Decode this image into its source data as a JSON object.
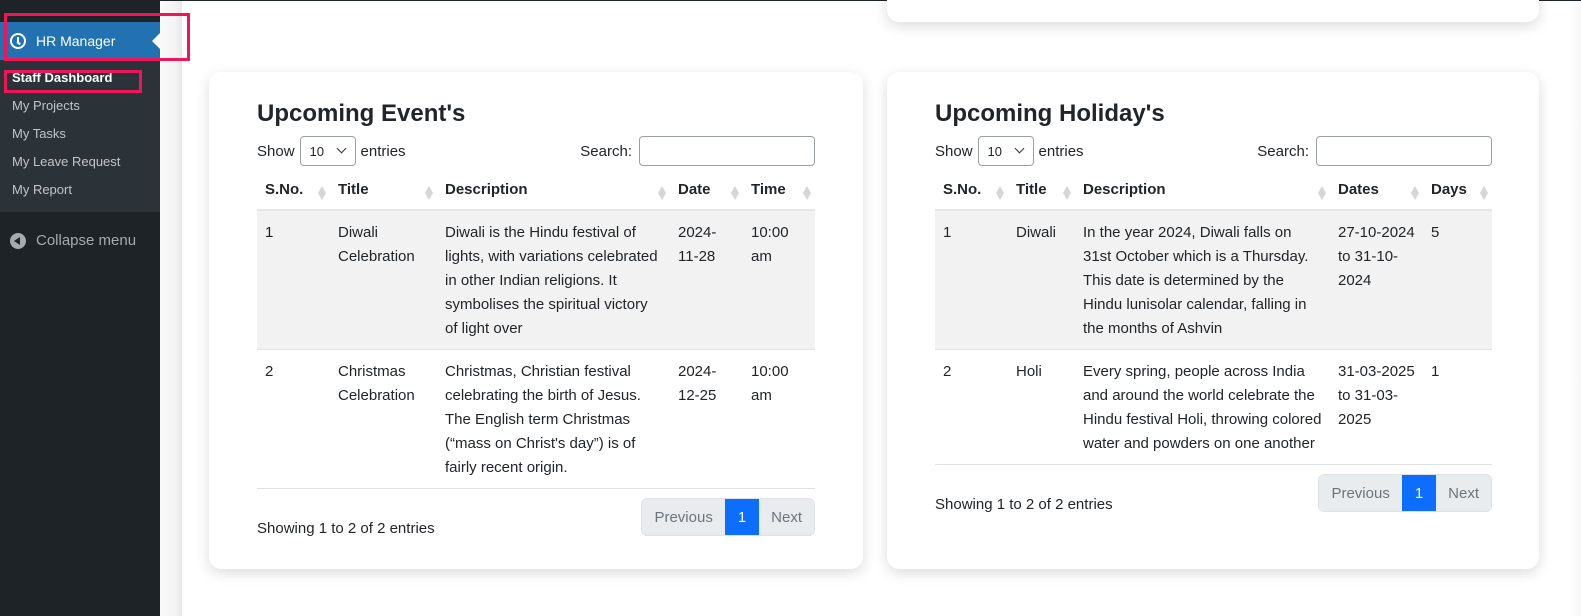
{
  "sidebar": {
    "menu_title": "HR Manager",
    "items": [
      {
        "label": "Staff Dashboard",
        "current": true
      },
      {
        "label": "My Projects"
      },
      {
        "label": "My Tasks"
      },
      {
        "label": "My Leave Request"
      },
      {
        "label": "My Report"
      }
    ],
    "collapse_label": "Collapse menu"
  },
  "colors": {
    "sidebar_bg": "#1d2327",
    "menu_active": "#2271b1",
    "highlight": "#f0145a",
    "page_active": "#0d6efd"
  },
  "events": {
    "title": "Upcoming Event's",
    "show_label": "Show",
    "entries_value": "10",
    "entries_label": "entries",
    "search_label": "Search:",
    "search_value": "",
    "columns": [
      "S.No.",
      "Title",
      "Description",
      "Date",
      "Time"
    ],
    "rows": [
      [
        "1",
        "Diwali Celebration",
        "Diwali is the Hindu festival of lights, with variations celebrated in other Indian religions. It symbolises the spiritual victory of light over",
        "2024-11-28",
        "10:00 am"
      ],
      [
        "2",
        "Christmas Celebration",
        "Christmas, Christian festival celebrating the birth of Jesus. The English term Christmas (“mass on Christ's day”) is of fairly recent origin.",
        "2024-12-25",
        "10:00 am"
      ]
    ],
    "info": "Showing 1 to 2 of 2 entries",
    "pager": {
      "previous": "Previous",
      "page": "1",
      "next": "Next"
    }
  },
  "holidays": {
    "title": "Upcoming Holiday's",
    "show_label": "Show",
    "entries_value": "10",
    "entries_label": "entries",
    "search_label": "Search:",
    "search_value": "",
    "columns": [
      "S.No.",
      "Title",
      "Description",
      "Dates",
      "Days"
    ],
    "rows": [
      [
        "1",
        "Diwali",
        "In the year 2024, Diwali falls on 31st October which is a Thursday. This date is determined by the Hindu lunisolar calendar, falling in the months of Ashvin",
        "27-10-2024 to 31-10-2024",
        "5"
      ],
      [
        "2",
        "Holi",
        "Every spring, people across India and around the world celebrate the Hindu festival Holi, throwing colored water and powders on one another",
        "31-03-2025 to 31-03-2025",
        "1"
      ]
    ],
    "info": "Showing 1 to 2 of 2 entries",
    "pager": {
      "previous": "Previous",
      "page": "1",
      "next": "Next"
    }
  }
}
